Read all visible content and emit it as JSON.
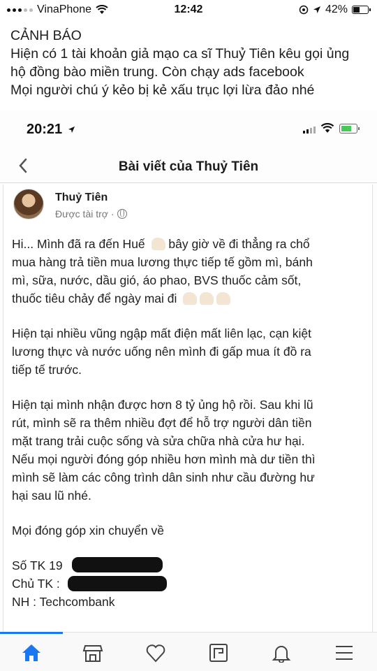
{
  "status_bar": {
    "carrier": "VinaPhone",
    "time": "12:42",
    "battery_percent": "42%",
    "battery_level": 0.42
  },
  "warning": {
    "lines": [
      "CẢNH BÁO",
      "Hiện có 1 tài khoản giả mạo ca sĩ Thuỷ Tiên kêu gọi ủng",
      "hộ đồng bào miền trung. Còn chạy ads facebook",
      "Mọi người chú ý kẻo bị kẻ xấu trục lợi lừa đảo nhé"
    ]
  },
  "inner_status_bar": {
    "time": "20:21"
  },
  "nav": {
    "title": "Bài viết của Thuỷ Tiên"
  },
  "post": {
    "author": "Thuỷ Tiên",
    "sponsored": "Được tài trợ ·",
    "paragraphs": [
      [
        "Hi... Mình đã ra đến Huế",
        "bây giờ về đi thẳng ra chổ",
        "mua hàng trả tiền mua lương thực tiếp tế gồm mì, bánh",
        "mì, sữa, nước, dầu gió, áo phao, BVS thuốc cảm sốt,",
        "thuốc tiêu chảy để ngày mai đi"
      ],
      [
        "Hiện tại nhiều vũng ngập mất điện mất liên lạc, cạn kiệt",
        "lương thực và nước uống nên mình đi gấp mua ít đồ ra",
        "tiếp tế trước."
      ],
      [
        "Hiện tại mình nhận được hơn 8 tỷ ủng hộ rồi. Sau khi lũ",
        "rút, mình sẽ ra thêm nhiều đợt để hỗ trợ người dân tiền",
        "mặt trang trải cuộc sống và sửa chữa nhà cửa hư hại.",
        "Nếu mọi người đóng góp nhiều hơn mình mà dư tiền thì",
        "mình sẽ làm các công trình dân sinh như cầu đường hư",
        "hại sau lũ nhé."
      ],
      [
        "Mọi đóng góp xin chuyển về"
      ]
    ],
    "account_number_label": "Số TK 19",
    "account_holder_label": "Chủ TK :",
    "bank_label": "NH : Techcombank"
  },
  "tab_bar": {
    "icons": [
      "home-icon",
      "marketplace-icon",
      "dating-heart-icon",
      "pages-icon",
      "notifications-bell-icon",
      "menu-icon"
    ],
    "active": "home-icon",
    "accent": "#1877f2"
  }
}
